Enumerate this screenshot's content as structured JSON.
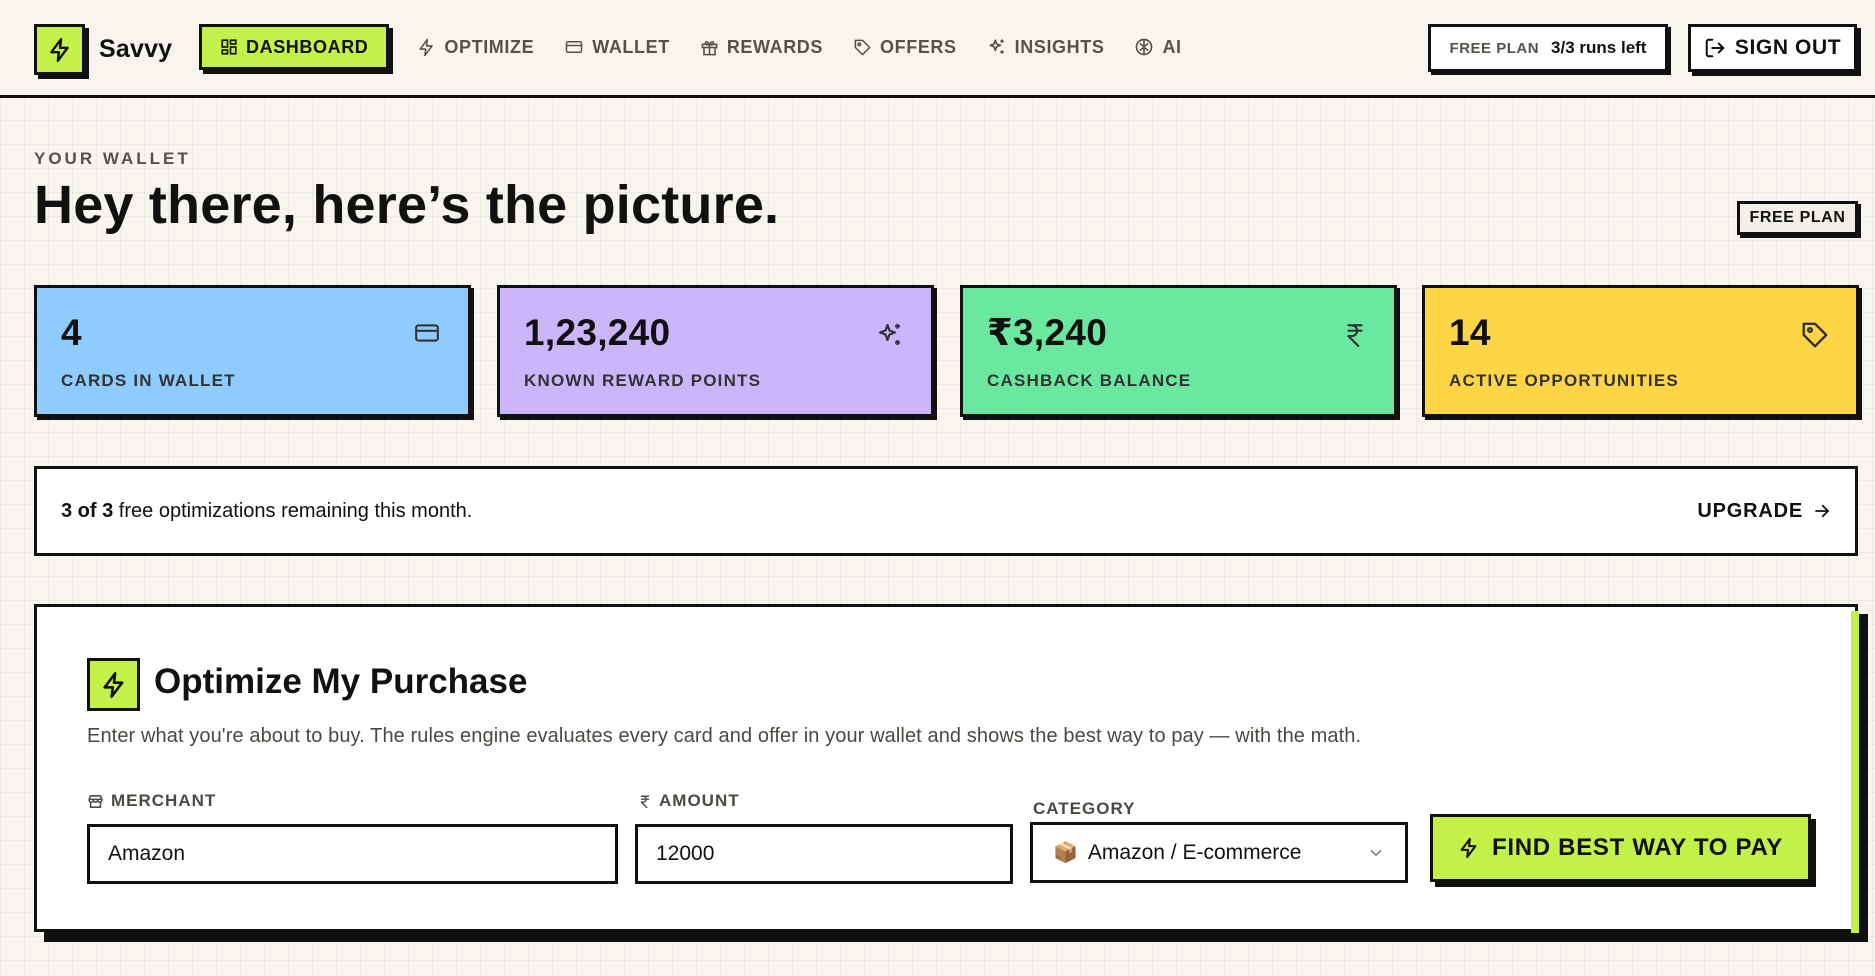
{
  "brand": {
    "name": "Savvy",
    "logo_icon": "bolt-icon"
  },
  "nav": {
    "items": [
      {
        "label": "DASHBOARD",
        "icon": "grid-icon",
        "active": true
      },
      {
        "label": "OPTIMIZE",
        "icon": "bolt-icon"
      },
      {
        "label": "WALLET",
        "icon": "card-icon"
      },
      {
        "label": "REWARDS",
        "icon": "gift-icon"
      },
      {
        "label": "OFFERS",
        "icon": "tag-icon"
      },
      {
        "label": "INSIGHTS",
        "icon": "sparkles-icon"
      },
      {
        "label": "AI",
        "icon": "brain-icon"
      }
    ]
  },
  "plan": {
    "label": "FREE PLAN",
    "runs": "3/3 runs left"
  },
  "signout_label": "SIGN OUT",
  "header": {
    "eyebrow": "YOUR WALLET",
    "title": "Hey there, here’s the picture.",
    "plan_badge": "FREE PLAN"
  },
  "stats": [
    {
      "value": "4",
      "label": "CARDS IN WALLET",
      "icon": "card-icon",
      "color": "#8ecbff"
    },
    {
      "value": "1,23,240",
      "label": "KNOWN REWARD POINTS",
      "icon": "sparkles-icon",
      "color": "#cdb5fb"
    },
    {
      "value": "₹3,240",
      "label": "CASHBACK BALANCE",
      "icon": "rupee-icon",
      "color": "#6be8a0"
    },
    {
      "value": "14",
      "label": "ACTIVE OPPORTUNITIES",
      "icon": "tag-icon",
      "color": "#fdd547"
    }
  ],
  "banner": {
    "count": "3 of 3",
    "text": " free optimizations remaining this month.",
    "upgrade_label": "UPGRADE"
  },
  "optimize": {
    "title": "Optimize My Purchase",
    "description": "Enter what you're about to buy. The rules engine evaluates every card and offer in your wallet and shows the best way to pay — with the math.",
    "merchant": {
      "label": "MERCHANT",
      "value": "Amazon"
    },
    "amount": {
      "label": "AMOUNT",
      "value": "12000"
    },
    "category": {
      "label": "CATEGORY",
      "emoji": "📦",
      "value": "Amazon / E-commerce"
    },
    "submit_label": "FIND BEST WAY TO PAY"
  },
  "colors": {
    "accent": "#c4f04a",
    "ink": "#111111",
    "background": "#f7f5ee"
  }
}
